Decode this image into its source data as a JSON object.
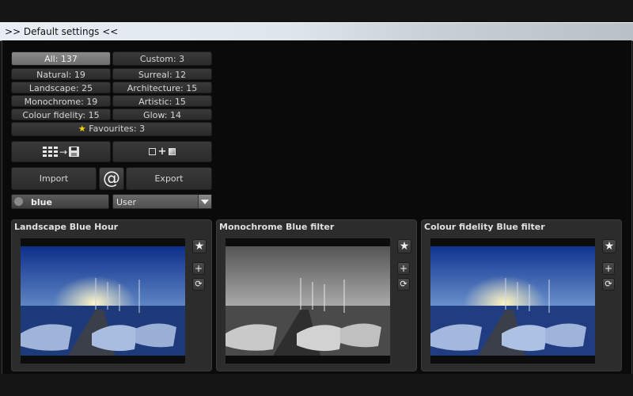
{
  "window": {
    "title": ">> Default settings <<"
  },
  "filters": [
    {
      "label": "All: 137",
      "active": true
    },
    {
      "label": "Custom: 3"
    },
    {
      "label": "Natural: 19"
    },
    {
      "label": "Surreal: 12"
    },
    {
      "label": "Landscape: 25"
    },
    {
      "label": "Architecture: 15"
    },
    {
      "label": "Monochrome: 19"
    },
    {
      "label": "Artistic: 15"
    },
    {
      "label": "Colour fidelity: 15"
    },
    {
      "label": "Glow: 14"
    }
  ],
  "favourites": {
    "label": "Favourites: 3",
    "icon": "star-icon"
  },
  "tools": {
    "grid_save_icon": "grid-to-save-icon",
    "compare_icon": "split-compare-icon"
  },
  "actions": {
    "import_label": "Import",
    "export_label": "Export",
    "at_label": "@"
  },
  "search": {
    "value": "blue"
  },
  "category_select": {
    "value": "User"
  },
  "presets": [
    {
      "title": "Landscape Blue Hour",
      "style": "color"
    },
    {
      "title": "Monochrome Blue filter",
      "style": "mono"
    },
    {
      "title": "Colour fidelity Blue filter",
      "style": "color"
    }
  ],
  "preset_actions": {
    "favourite_icon": "star-icon",
    "add_label": "+",
    "sync_icon": "refresh-icon"
  },
  "colors": {
    "accent_active": "#7a7a7a",
    "panel_bg": "#0a0a0a",
    "card_bg": "#2c2c2c",
    "star": "#f5d400"
  }
}
